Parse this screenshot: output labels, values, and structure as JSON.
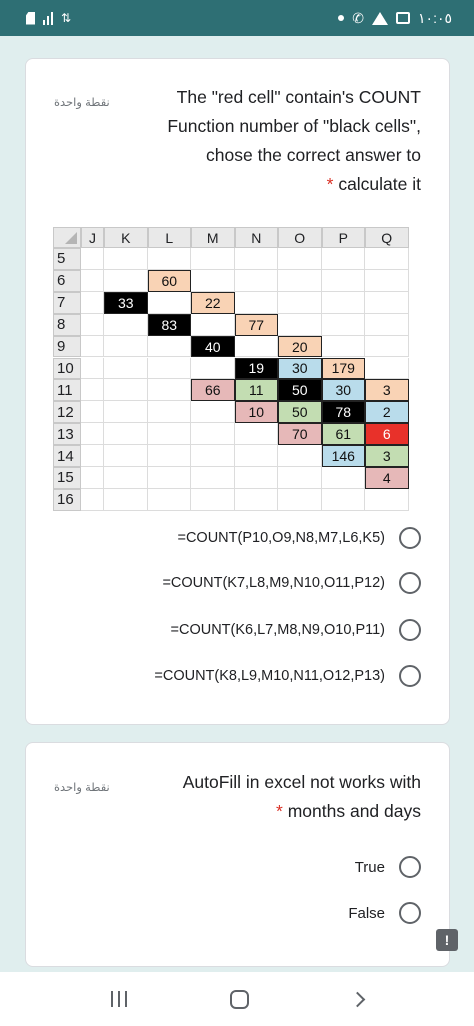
{
  "status_bar": {
    "time": "١٠:٠٥",
    "left_icons": [
      "sim-icon",
      "signal-bars-icon",
      "data-arrows-icon"
    ],
    "right_icons": [
      "notification-dot-icon",
      "call-icon",
      "warning-icon",
      "image-icon"
    ]
  },
  "question1": {
    "title": "The \"red cell\" contain's COUNT Function number of \"black cells\", chose the correct answer to",
    "title_end": "calculate it",
    "required_mark": "*",
    "points": "نقطة واحدة",
    "options": [
      "=COUNT(P10,O9,N8,M7,L6,K5)",
      "=COUNT(K7,L8,M9,N10,O11,P12)",
      "=COUNT(K6,L7,M8,N9,O10,P11)",
      "=COUNT(K8,L9,M10,N11,O12,P13)"
    ]
  },
  "spreadsheet": {
    "columns": [
      "J",
      "K",
      "L",
      "M",
      "N",
      "O",
      "P",
      "Q"
    ],
    "rows": [
      "5",
      "6",
      "7",
      "8",
      "9",
      "10",
      "11",
      "12",
      "13",
      "14",
      "15",
      "16"
    ],
    "cells": [
      {
        "col": "L",
        "row": "6",
        "value": "60",
        "color": "peach"
      },
      {
        "col": "K",
        "row": "7",
        "value": "33",
        "color": "black"
      },
      {
        "col": "M",
        "row": "7",
        "value": "22",
        "color": "peach"
      },
      {
        "col": "L",
        "row": "8",
        "value": "83",
        "color": "black"
      },
      {
        "col": "N",
        "row": "8",
        "value": "77",
        "color": "peach"
      },
      {
        "col": "M",
        "row": "9",
        "value": "40",
        "color": "black"
      },
      {
        "col": "O",
        "row": "9",
        "value": "20",
        "color": "peach"
      },
      {
        "col": "N",
        "row": "10",
        "value": "19",
        "color": "black"
      },
      {
        "col": "O",
        "row": "10",
        "value": "30",
        "color": "blue"
      },
      {
        "col": "P",
        "row": "10",
        "value": "179",
        "color": "peach"
      },
      {
        "col": "M",
        "row": "11",
        "value": "66",
        "color": "pink"
      },
      {
        "col": "N",
        "row": "11",
        "value": "11",
        "color": "green"
      },
      {
        "col": "O",
        "row": "11",
        "value": "50",
        "color": "black"
      },
      {
        "col": "P",
        "row": "11",
        "value": "30",
        "color": "blue"
      },
      {
        "col": "Q",
        "row": "11",
        "value": "3",
        "color": "peach"
      },
      {
        "col": "N",
        "row": "12",
        "value": "10",
        "color": "pink"
      },
      {
        "col": "O",
        "row": "12",
        "value": "50",
        "color": "green"
      },
      {
        "col": "P",
        "row": "12",
        "value": "78",
        "color": "black"
      },
      {
        "col": "Q",
        "row": "12",
        "value": "2",
        "color": "blue"
      },
      {
        "col": "O",
        "row": "13",
        "value": "70",
        "color": "pink"
      },
      {
        "col": "P",
        "row": "13",
        "value": "61",
        "color": "green"
      },
      {
        "col": "Q",
        "row": "13",
        "value": "6",
        "color": "red"
      },
      {
        "col": "P",
        "row": "14",
        "value": "146",
        "color": "blue"
      },
      {
        "col": "Q",
        "row": "14",
        "value": "3",
        "color": "green"
      },
      {
        "col": "Q",
        "row": "15",
        "value": "4",
        "color": "pink"
      }
    ]
  },
  "question2": {
    "title": "AutoFill in excel not works with",
    "title_end": "months and days",
    "required_mark": "*",
    "points": "نقطة واحدة",
    "options": [
      "True",
      "False"
    ]
  },
  "feedback_icon_label": "!",
  "nav_bar": {
    "icons": [
      "recent-apps-icon",
      "home-icon",
      "back-icon"
    ]
  }
}
